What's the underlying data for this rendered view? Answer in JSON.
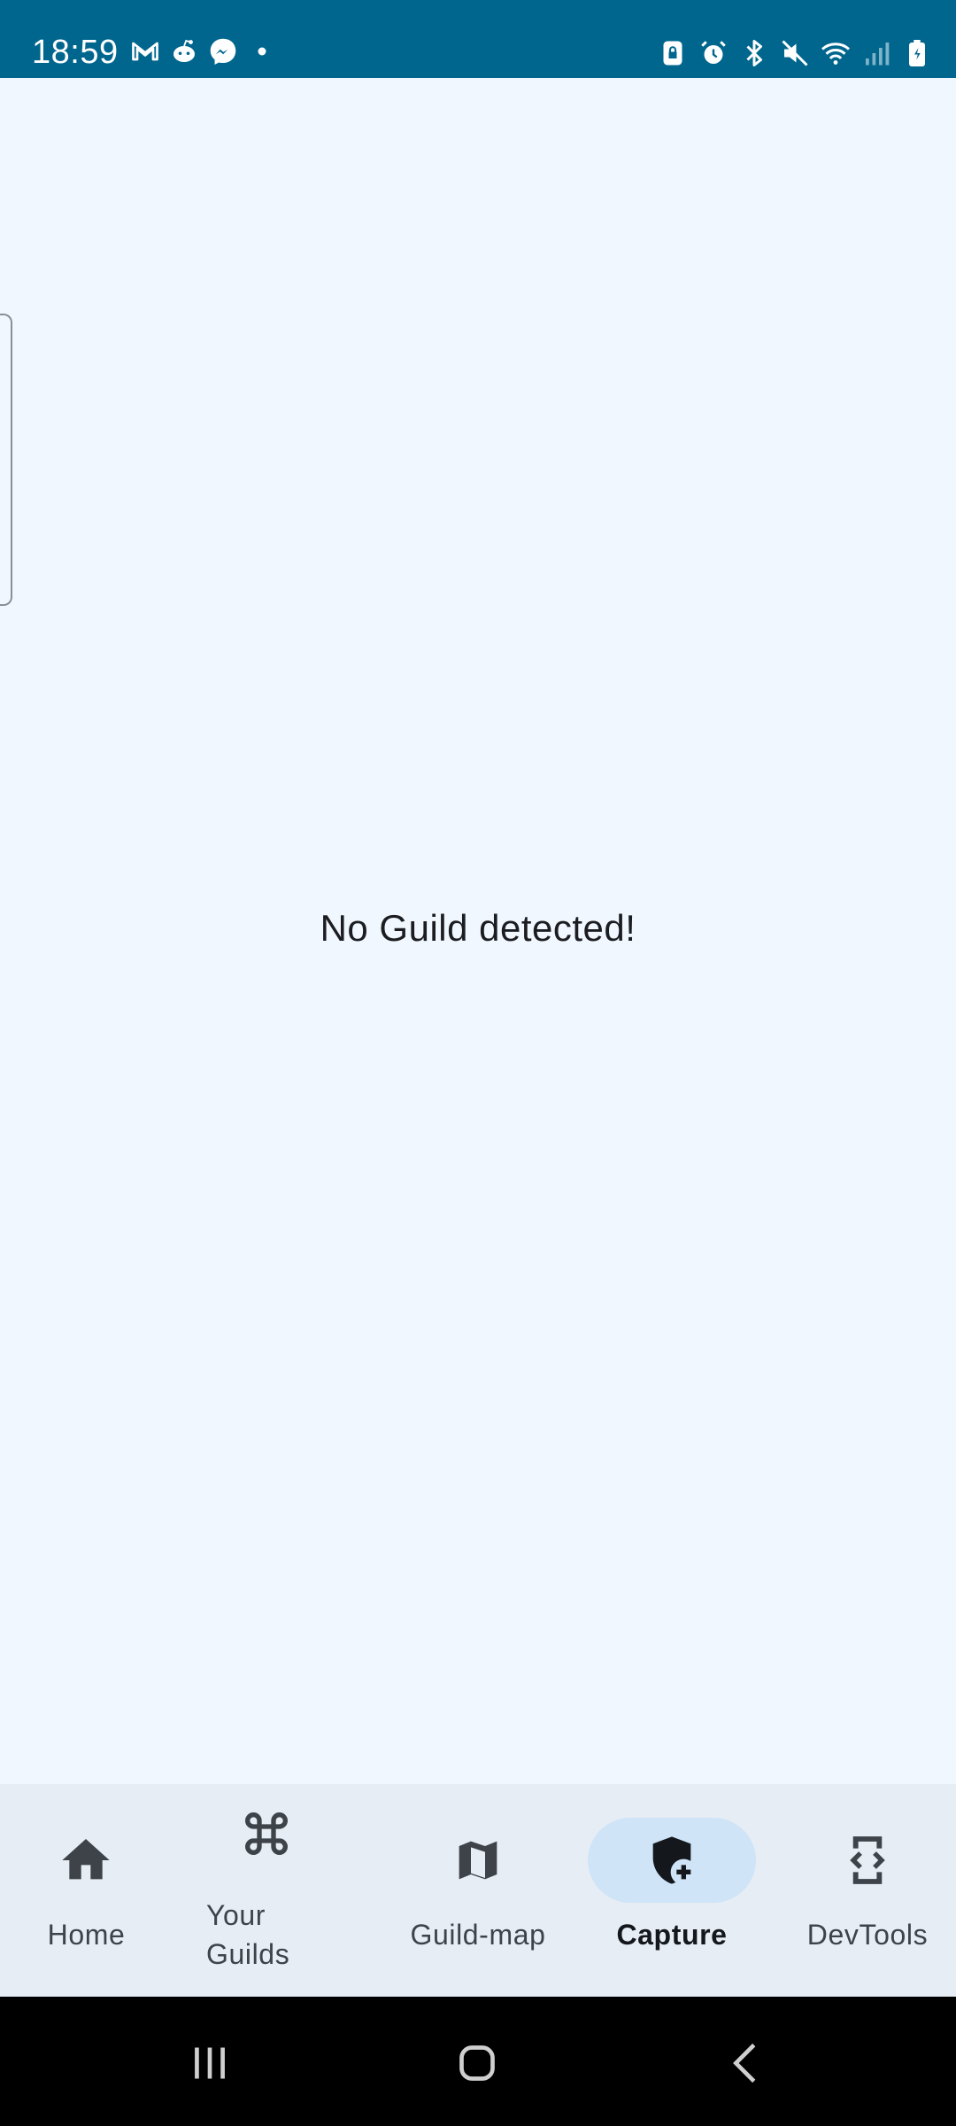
{
  "status_bar": {
    "time": "18:59",
    "left_icons": [
      "gmail-icon",
      "reddit-icon",
      "messenger-icon",
      "dot-icon"
    ],
    "right_icons": [
      "lock-rotation-icon",
      "alarm-icon",
      "bluetooth-icon",
      "mute-icon",
      "wifi-icon",
      "signal-icon",
      "battery-icon"
    ]
  },
  "main": {
    "empty_message": "No Guild detected!"
  },
  "bottom_nav": {
    "items": [
      {
        "label": "Home",
        "icon": "home-icon",
        "active": false
      },
      {
        "label": "Your\nGuilds",
        "icon": "command-icon",
        "active": false
      },
      {
        "label": "Guild-map",
        "icon": "map-icon",
        "active": false
      },
      {
        "label": "Capture",
        "icon": "shield-add-icon",
        "active": true
      },
      {
        "label": "DevTools",
        "icon": "devtools-icon",
        "active": false
      }
    ]
  },
  "colors": {
    "status_bar": "#00668E",
    "background": "#F1F7FE",
    "nav_background": "#E6EDF5",
    "active_pill": "#CFE4F6"
  }
}
